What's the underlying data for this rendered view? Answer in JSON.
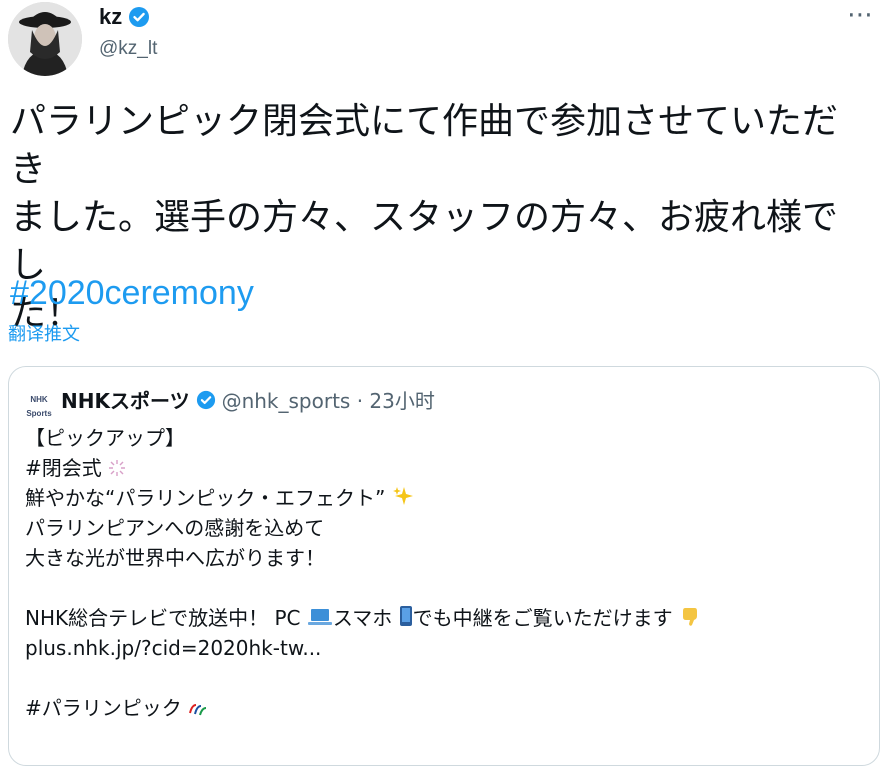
{
  "author": {
    "display_name": "kz",
    "handle": "@kz_lt",
    "verified": true
  },
  "more_icon": "⋯",
  "tweet": {
    "text": "パラリンピック閉会式にて作曲で参加させていただき\nました。選手の方々、スタッフの方々、お疲れ様でし\nた！",
    "hashtag": "#2020ceremony",
    "translate_label": "翻译推文"
  },
  "quote": {
    "logo_text": "NHK Sports",
    "display_name": "NHKスポーツ",
    "handle_time": "@nhk_sports · 23小时",
    "lines": [
      "【ピックアップ】",
      " #閉会式",
      "鮮やかな“パラリンピック・エフェクト”",
      "パラリンピアンへの感謝を込めて",
      "大きな光が世界中へ広がります！",
      "",
      "NHK総合テレビで放送中！ PC",
      "plus.nhk.jp/?cid=2020hk-tw...",
      "",
      "#パラリンピック"
    ],
    "line7_middle": "スマホ",
    "line7_end": "でも中継をご覧いただけます"
  },
  "colors": {
    "accent": "#1d9bf0",
    "secondary_text": "#536471",
    "border": "#cfd9de"
  }
}
